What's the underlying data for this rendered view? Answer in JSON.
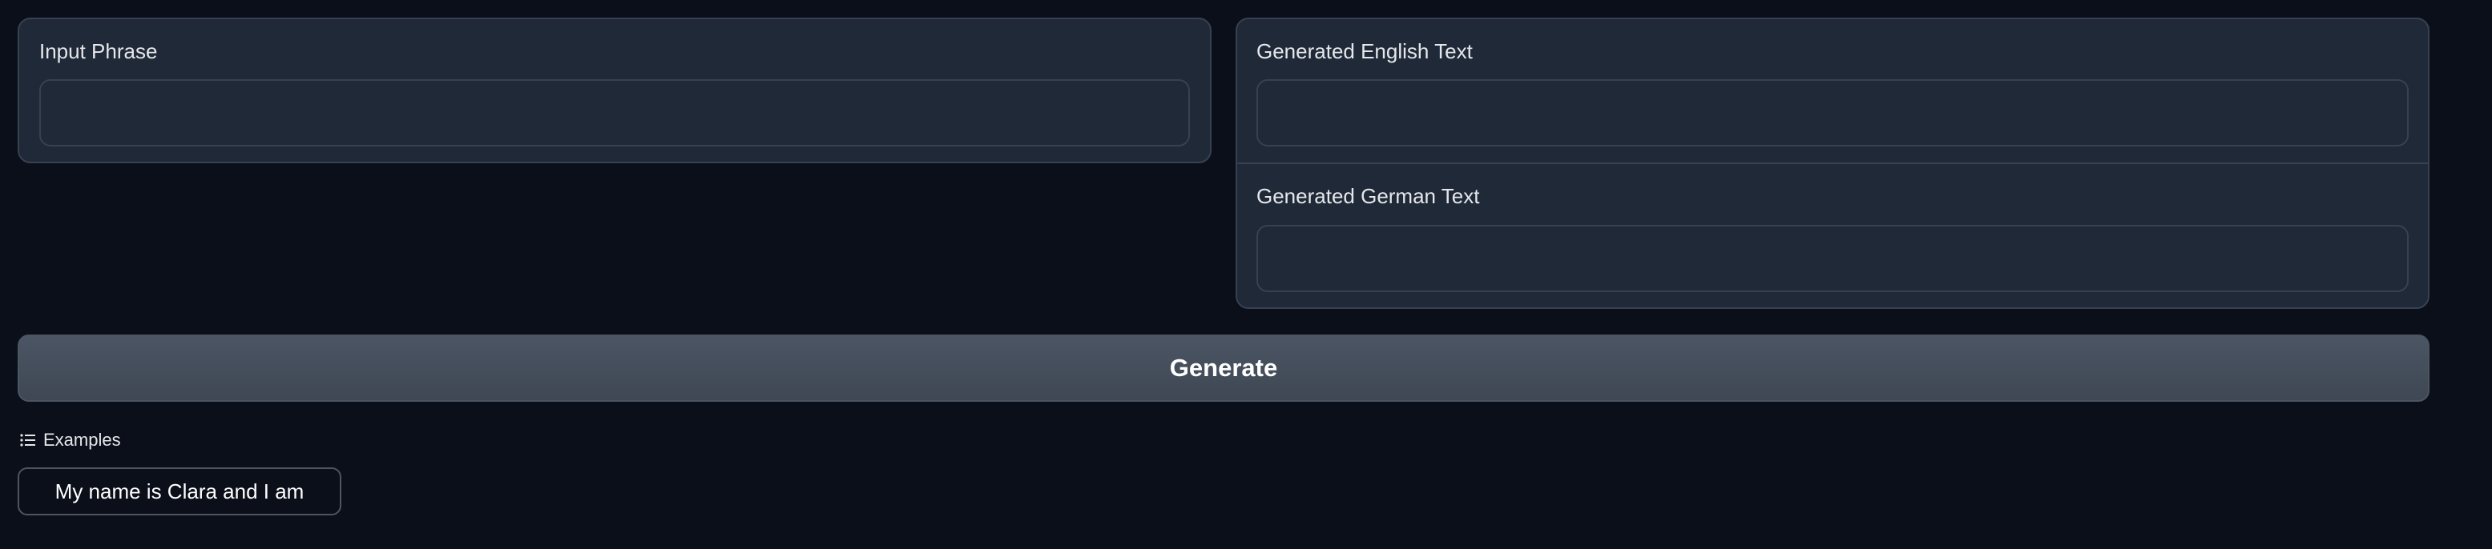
{
  "input_panel": {
    "label": "Input Phrase",
    "value": "",
    "placeholder": ""
  },
  "output_panel": {
    "english_label": "Generated English Text",
    "english_value": "",
    "german_label": "Generated German Text",
    "german_value": ""
  },
  "actions": {
    "generate_label": "Generate"
  },
  "examples": {
    "header_label": "Examples",
    "icon": "list-icon",
    "items": [
      "My name is Clara and I am"
    ]
  },
  "colors": {
    "background": "#0b0f19",
    "panel": "#1f2937",
    "border": "#374151",
    "button": "#4b5563",
    "text": "#e5e7eb"
  }
}
